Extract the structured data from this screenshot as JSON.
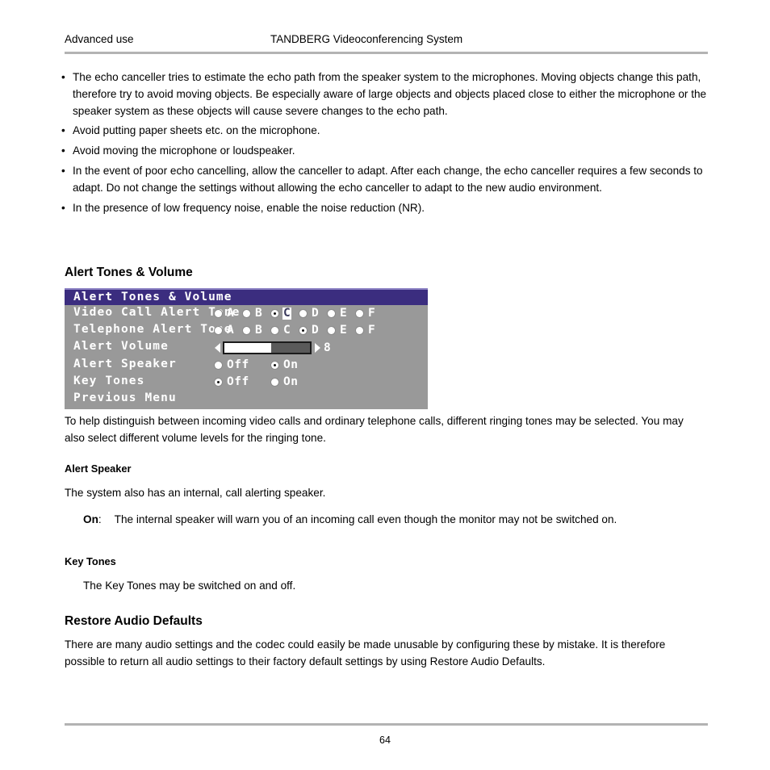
{
  "header": {
    "left": "Advanced use",
    "center": "TANDBERG Videoconferencing System"
  },
  "bullets": [
    "The echo canceller tries to estimate the echo path from the speaker system to the microphones. Moving objects change this path, therefore try to avoid moving objects. Be especially aware of large objects and objects placed close to either the microphone or the speaker system as these objects will cause severe changes to the echo path.",
    "Avoid putting paper sheets etc. on the microphone.",
    "Avoid moving the microphone or loudspeaker.",
    "In the event of poor echo cancelling, allow the canceller to adapt. After each change, the echo canceller requires a few seconds to adapt. Do not change the settings without allowing the echo canceller to adapt to the new audio environment.",
    "In the presence of low frequency noise, enable the noise reduction (NR)."
  ],
  "bullet_marker": "•",
  "sections": {
    "alert_tones_heading": "Alert Tones & Volume",
    "alert_tones_paragraph": "To help distinguish between incoming video calls and ordinary telephone calls, different ringing tones may be selected. You may also select different volume levels for the ringing tone.",
    "alert_speaker_heading": "Alert Speaker",
    "alert_speaker_paragraph": "The system also has an internal, call alerting speaker.",
    "alert_speaker_def_term": "On",
    "alert_speaker_def_colon": ":",
    "alert_speaker_def_text": "The internal speaker will warn you of an incoming call even though the monitor may not be switched on.",
    "key_tones_heading": "Key Tones",
    "key_tones_paragraph": "The Key Tones may be switched on and off.",
    "restore_heading": "Restore Audio Defaults",
    "restore_paragraph": "There are many audio settings and the codec could easily be made unusable by configuring these by mistake. It is therefore possible to return all audio settings to their factory default settings by using Restore Audio Defaults."
  },
  "osd": {
    "title": "Alert Tones & Volume",
    "title_bar_color": "#3b2d7f",
    "body_color": "#999999",
    "text_color": "#ffffff",
    "rows": {
      "video_call_alert_tone": {
        "label": "Video Call Alert Tone",
        "options": [
          "A",
          "B",
          "C",
          "D",
          "E",
          "F"
        ],
        "selected": "C",
        "cursor": "C"
      },
      "telephone_alert_tone": {
        "label": "Telephone Alert Tone",
        "options": [
          "A",
          "B",
          "C",
          "D",
          "E",
          "F"
        ],
        "selected": "D",
        "cursor": ""
      },
      "alert_volume": {
        "label": "Alert Volume",
        "value": "8",
        "fill_percent": 55,
        "left_arrow": "◀",
        "right_arrow": "▶"
      },
      "alert_speaker": {
        "label": "Alert Speaker",
        "options": [
          "Off",
          "On"
        ],
        "selected": "On"
      },
      "key_tones": {
        "label": "Key Tones",
        "options": [
          "Off",
          "On"
        ],
        "selected": "Off"
      },
      "previous_menu": {
        "label": "Previous Menu"
      }
    }
  },
  "footer": {
    "page_number": "64"
  }
}
